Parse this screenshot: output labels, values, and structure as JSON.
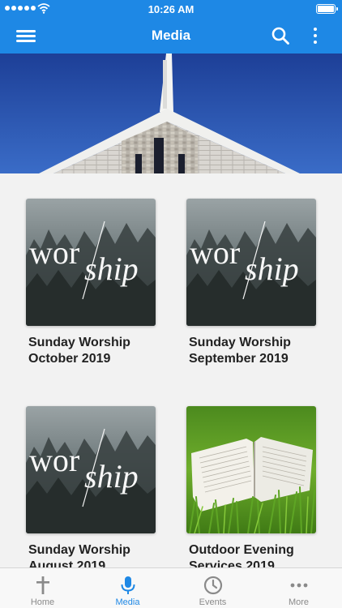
{
  "status_bar": {
    "time": "10:26 AM"
  },
  "nav": {
    "title": "Media"
  },
  "hero": {
    "image": "church-steeple-photo"
  },
  "media_items": [
    {
      "line1": "Sunday Worship",
      "line2": "October 2019",
      "thumbnail": "worship-forest-art"
    },
    {
      "line1": "Sunday Worship",
      "line2": "September 2019",
      "thumbnail": "worship-forest-art"
    },
    {
      "line1": "Sunday Worship",
      "line2": "August 2019",
      "thumbnail": "worship-forest-art"
    },
    {
      "line1": "Outdoor Evening",
      "line2": "Services 2019",
      "thumbnail": "bible-on-grass-photo"
    }
  ],
  "artwork": {
    "worship_a": "wor",
    "worship_b": "ship"
  },
  "tabs": [
    {
      "label": "Home",
      "icon": "cross-icon"
    },
    {
      "label": "Media",
      "icon": "microphone-icon",
      "active": true
    },
    {
      "label": "Events",
      "icon": "clock-icon"
    },
    {
      "label": "More",
      "icon": "ellipsis-icon"
    }
  ],
  "colors": {
    "brand": "#1e88e5",
    "inactive": "#8a8a8a"
  }
}
